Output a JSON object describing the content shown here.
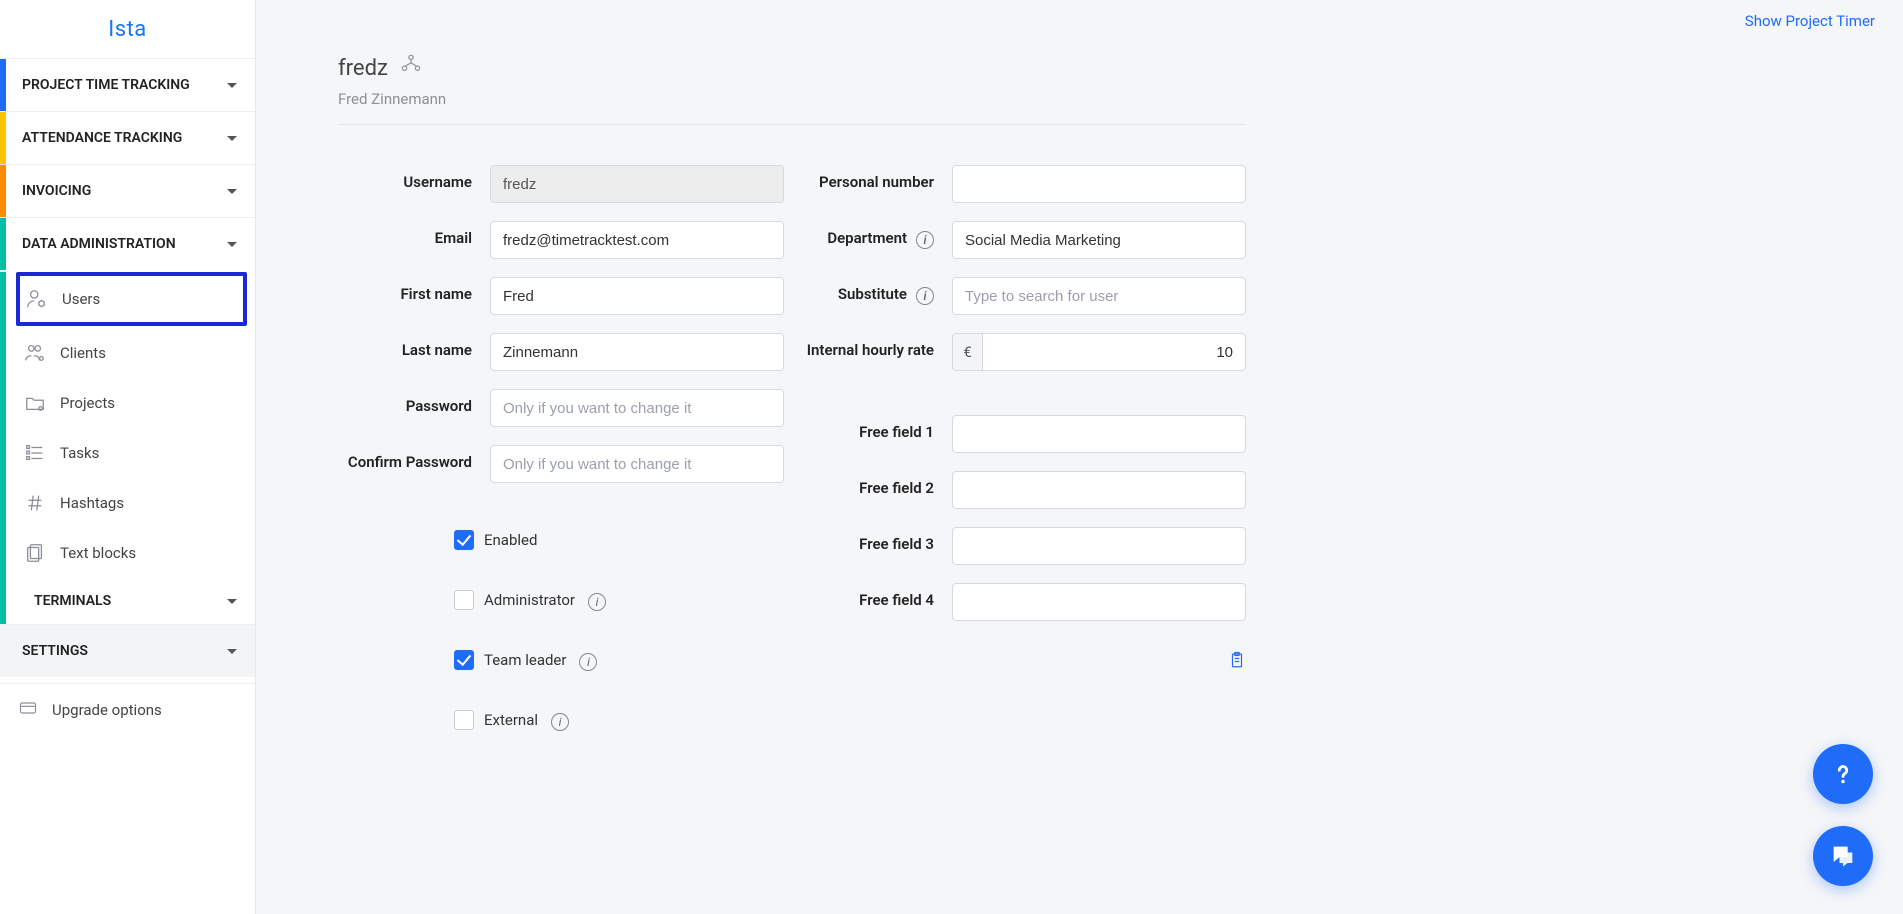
{
  "brand": "Ista",
  "topbar": {
    "show_timer": "Show Project Timer"
  },
  "sidebar": {
    "sections": {
      "project_time": "PROJECT TIME TRACKING",
      "attendance": "ATTENDANCE TRACKING",
      "invoicing": "INVOICING",
      "data_admin": "DATA ADMINISTRATION",
      "terminals": "TERMINALS",
      "settings": "SETTINGS"
    },
    "data_admin_items": {
      "users": "Users",
      "clients": "Clients",
      "projects": "Projects",
      "tasks": "Tasks",
      "hashtags": "Hashtags",
      "textblocks": "Text blocks"
    },
    "upgrade": "Upgrade options"
  },
  "user_header": {
    "username": "fredz",
    "fullname": "Fred Zinnemann"
  },
  "labels": {
    "username": "Username",
    "email": "Email",
    "first_name": "First name",
    "last_name": "Last name",
    "password": "Password",
    "confirm_password": "Confirm Password",
    "personal_number": "Personal number",
    "department": "Department",
    "substitute": "Substitute",
    "internal_rate": "Internal hourly rate",
    "free1": "Free field 1",
    "free2": "Free field 2",
    "free3": "Free field 3",
    "free4": "Free field 4"
  },
  "values": {
    "username": "fredz",
    "email": "fredz@timetracktest.com",
    "first_name": "Fred",
    "last_name": "Zinnemann",
    "password": "",
    "confirm_password": "",
    "personal_number": "",
    "department": "Social Media Marketing",
    "substitute": "",
    "rate_currency": "€",
    "rate_value": "10",
    "free1": "",
    "free2": "",
    "free3": "",
    "free4": ""
  },
  "placeholders": {
    "password": "Only if you want to change it",
    "confirm_password": "Only if you want to change it",
    "substitute": "Type to search for user"
  },
  "checkboxes": {
    "enabled": {
      "label": "Enabled",
      "checked": true
    },
    "administrator": {
      "label": "Administrator",
      "checked": false
    },
    "team_leader": {
      "label": "Team leader",
      "checked": true
    },
    "external": {
      "label": "External",
      "checked": false
    }
  }
}
